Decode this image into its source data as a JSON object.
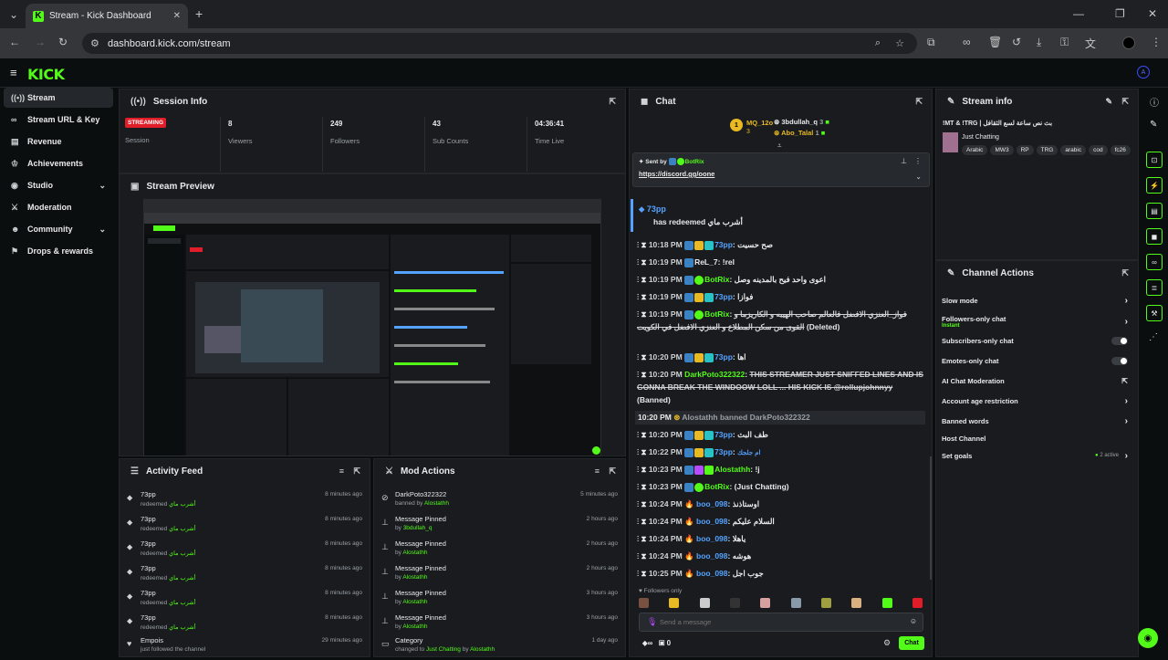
{
  "browser": {
    "tab_title": "Stream - Kick Dashboard",
    "url": "dashboard.kick.com/stream"
  },
  "logo": "KICK",
  "sidebar": {
    "items": [
      {
        "label": "Stream",
        "icon": "signal-icon"
      },
      {
        "label": "Stream URL & Key",
        "icon": "link-icon"
      },
      {
        "label": "Revenue",
        "icon": "revenue-icon"
      },
      {
        "label": "Achievements",
        "icon": "trophy-icon"
      },
      {
        "label": "Studio",
        "icon": "studio-icon"
      },
      {
        "label": "Moderation",
        "icon": "sword-icon"
      },
      {
        "label": "Community",
        "icon": "community-icon"
      },
      {
        "label": "Drops & rewards",
        "icon": "gift-icon"
      }
    ]
  },
  "session": {
    "title": "Session Info",
    "status_badge": "STREAMING",
    "status_label": "Session",
    "stats": [
      {
        "value": "8",
        "label": "Viewers"
      },
      {
        "value": "249",
        "label": "Followers"
      },
      {
        "value": "43",
        "label": "Sub Counts"
      },
      {
        "value": "04:36:41",
        "label": "Time Live"
      }
    ]
  },
  "preview": {
    "title": "Stream Preview"
  },
  "activity": {
    "title": "Activity Feed",
    "items": [
      {
        "name": "73pp",
        "action": "redeemed",
        "detail": "أشرب ماي",
        "time": "8 minutes ago"
      },
      {
        "name": "73pp",
        "action": "redeemed",
        "detail": "أشرب ماي",
        "time": "8 minutes ago"
      },
      {
        "name": "73pp",
        "action": "redeemed",
        "detail": "أشرب ماي",
        "time": "8 minutes ago"
      },
      {
        "name": "73pp",
        "action": "redeemed",
        "detail": "أشرب ماي",
        "time": "8 minutes ago"
      },
      {
        "name": "73pp",
        "action": "redeemed",
        "detail": "أشرب ماي",
        "time": "8 minutes ago"
      },
      {
        "name": "73pp",
        "action": "redeemed",
        "detail": "أشرب ماي",
        "time": "8 minutes ago"
      },
      {
        "name": "Empois",
        "action": "just followed the channel",
        "detail": "",
        "time": "29 minutes ago"
      }
    ]
  },
  "mod": {
    "title": "Mod Actions",
    "items": [
      {
        "name": "DarkPoto322322",
        "action": "banned by",
        "who": "Alostathh",
        "time": "5 minutes ago"
      },
      {
        "name": "Message Pinned",
        "action": "by",
        "who": "3bdullah_q",
        "time": "2 hours ago"
      },
      {
        "name": "Message Pinned",
        "action": "by",
        "who": "Alostathh",
        "time": "2 hours ago"
      },
      {
        "name": "Message Pinned",
        "action": "by",
        "who": "Alostathh",
        "time": "2 hours ago"
      },
      {
        "name": "Message Pinned",
        "action": "by",
        "who": "Alostathh",
        "time": "3 hours ago"
      },
      {
        "name": "Message Pinned",
        "action": "by",
        "who": "Alostathh",
        "time": "3 hours ago"
      },
      {
        "name": "Category",
        "action": "changed to",
        "who": "Just Chatting",
        "by": "by",
        "who2": "Alostathh",
        "time": "1 day ago"
      }
    ]
  },
  "chat": {
    "title": "Chat",
    "leaders": [
      {
        "name": "MQ_12o",
        "count": "3"
      },
      {
        "name": "3bdullah_q",
        "count": "3"
      },
      {
        "name": "Abo_Talal",
        "count": "1"
      }
    ],
    "pinned": {
      "sent_by": "Sent by",
      "user": "BotRix",
      "link": "https://discord.gg/oone"
    },
    "redeem": {
      "user": "73pp",
      "text": "has redeemed",
      "reward": "أشرب ماي"
    },
    "messages": [
      {
        "time": "10:18 PM",
        "user": "73pp",
        "text": "صح حسيت"
      },
      {
        "time": "10:19 PM",
        "user": "ReL_7",
        "text": "!rel"
      },
      {
        "time": "10:19 PM",
        "user": "BotRix",
        "text": "اعوى واحد فيح بالمدينه وصل"
      },
      {
        "time": "10:19 PM",
        "user": "73pp",
        "text": "فوازا"
      },
      {
        "time": "10:19 PM",
        "user": "BotRix",
        "text": "فواز_العنزي الافضل فالعالم صاحب الهيبه و الكاريزما و القوى من سكن المطلاع و العنزي الافضل في الكويت",
        "tail": "(Deleted)"
      },
      {
        "time": "10:20 PM",
        "user": "73pp",
        "text": "اها"
      },
      {
        "time": "10:20 PM",
        "user": "DarkPoto322322",
        "text": "THIS STREAMER JUST SNIFFED LINES AND IS GONNA BREAK THE WINDOOW LOLL ... HIS KICK IS @rollupjohnnyy",
        "tail": "(Banned)"
      },
      {
        "time": "10:20 PM",
        "user": "Alostathh",
        "text": "banned DarkPoto322322"
      },
      {
        "time": "10:20 PM",
        "user": "73pp",
        "text": "طف البث"
      },
      {
        "time": "10:22 PM",
        "user": "73pp",
        "text": "ام جلجك"
      },
      {
        "time": "10:23 PM",
        "user": "Alostathh",
        "text": "!j"
      },
      {
        "time": "10:23 PM",
        "user": "BotRix",
        "text": "(Just Chatting)"
      },
      {
        "time": "10:24 PM",
        "user": "boo_098",
        "text": "اوستاذنذ"
      },
      {
        "time": "10:24 PM",
        "user": "boo_098",
        "text": "السلام عليكم"
      },
      {
        "time": "10:24 PM",
        "user": "boo_098",
        "text": "ياهلا"
      },
      {
        "time": "10:24 PM",
        "user": "boo_098",
        "text": "هوشه"
      },
      {
        "time": "10:25 PM",
        "user": "boo_098",
        "text": "جوب اجل"
      }
    ],
    "followers_only": "Followers only",
    "placeholder": "Send a message",
    "footer_count": "0",
    "send_label": "Chat"
  },
  "stream_info": {
    "title": "Stream info",
    "stream_title": "!MT & !TRG | بث نص ساعة لسع الثقافل",
    "category": "Just Chatting",
    "tags": [
      "Arabic",
      "MW3",
      "RP",
      "TRG",
      "arabic",
      "cod",
      "fc26"
    ]
  },
  "channel_actions": {
    "title": "Channel Actions",
    "items": [
      {
        "label": "Slow mode",
        "control": "chevron"
      },
      {
        "label": "Followers-only chat",
        "sub": "Instant",
        "control": "chevron"
      },
      {
        "label": "Subscribers-only chat",
        "control": "toggle"
      },
      {
        "label": "Emotes-only chat",
        "control": "toggle"
      },
      {
        "label": "AI Chat Moderation",
        "control": "external"
      },
      {
        "label": "Account age restriction",
        "control": "chevron"
      },
      {
        "label": "Banned words",
        "control": "chevron"
      },
      {
        "label": "Host Channel",
        "control": "none"
      },
      {
        "label": "Set goals",
        "extra": "2 active",
        "control": "chevron"
      }
    ]
  },
  "colors": {
    "accent": "#53fc18",
    "panel": "#191b1f",
    "bg": "#0b0e0f",
    "live": "#e11d2a",
    "link": "#53a3ff"
  }
}
